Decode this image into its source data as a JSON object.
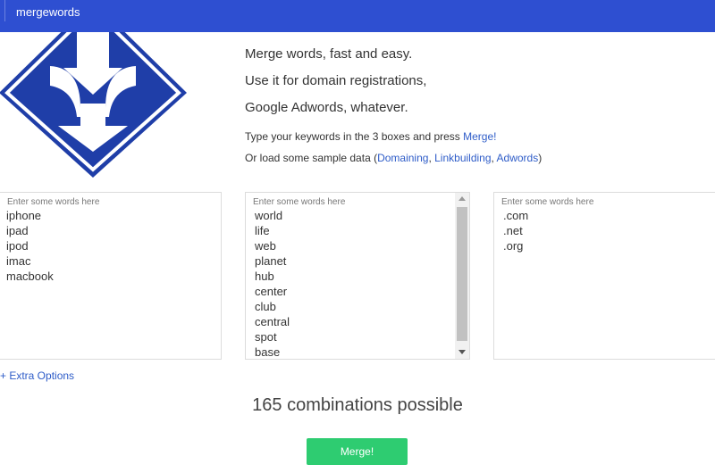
{
  "app": {
    "brand": "mergewords"
  },
  "colors": {
    "topbar": "#2e4fd1",
    "logo": "#1f3ea8",
    "link": "#2e5cc8",
    "merge_button": "#2ecc71"
  },
  "taglines": [
    "Merge words, fast and easy.",
    "Use it for domain registrations,",
    "Google Adwords, whatever."
  ],
  "instructions": {
    "line1_prefix": "Type your keywords in the 3 boxes and press ",
    "merge_link": "Merge!",
    "line2_prefix": "Or load some sample data (",
    "sample_links": [
      "Domaining",
      "Linkbuilding",
      "Adwords"
    ],
    "separator": ", ",
    "line2_suffix": ")"
  },
  "boxes": [
    {
      "placeholder": "Enter some words here",
      "words": [
        "iphone",
        "ipad",
        "ipod",
        "imac",
        "macbook"
      ]
    },
    {
      "placeholder": "Enter some words here",
      "words": [
        "world",
        "life",
        "web",
        "planet",
        "hub",
        "center",
        "club",
        "central",
        "spot",
        "base"
      ]
    },
    {
      "placeholder": "Enter some words here",
      "words": [
        ".com",
        ".net",
        ".org"
      ]
    }
  ],
  "extra_options": "+ Extra Options",
  "combinations": "165 combinations possible",
  "merge_button": "Merge!"
}
